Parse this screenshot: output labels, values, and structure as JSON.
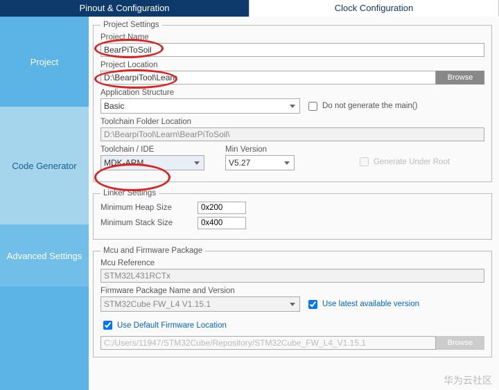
{
  "tabs": {
    "pinout": "Pinout & Configuration",
    "clock": "Clock Configuration"
  },
  "sidebar": {
    "project": "Project",
    "codegen": "Code Generator",
    "advanced": "Advanced Settings"
  },
  "projectSettings": {
    "legend": "Project Settings",
    "nameLabel": "Project Name",
    "nameValue": "BearPiToSoil",
    "locLabel": "Project Location",
    "locValue": "D:\\BearpiTool\\Learn",
    "browse": "Browse",
    "appStructLabel": "Application Structure",
    "appStructValue": "Basic",
    "noMain": "Do not generate the main()",
    "tcFolderLabel": "Toolchain Folder Location",
    "tcFolderValue": "D:\\BearpiTool\\Learn\\BearPiToSoil\\",
    "ideLabel": "Toolchain / IDE",
    "ideValue": "MDK-ARM",
    "minVerLabel": "Min Version",
    "minVerValue": "V5.27",
    "underRoot": "Generate Under Root"
  },
  "linker": {
    "legend": "Linker Settings",
    "heapLabel": "Minimum Heap Size",
    "heapValue": "0x200",
    "stackLabel": "Minimum Stack Size",
    "stackValue": "0x400"
  },
  "mcu": {
    "legend": "Mcu and Firmware Package",
    "refLabel": "Mcu Reference",
    "refValue": "STM32L431RCTx",
    "fwLabel": "Firmware Package Name and Version",
    "fwValue": "STM32Cube FW_L4 V1.15.1",
    "useLatest": "Use latest available version",
    "useDefault": "Use Default Firmware Location",
    "defaultPath": "C:/Users/11947/STM32Cube/Repository/STM32Cube_FW_L4_V1.15.1",
    "browse": "Browse"
  },
  "watermark": "华为云社区"
}
